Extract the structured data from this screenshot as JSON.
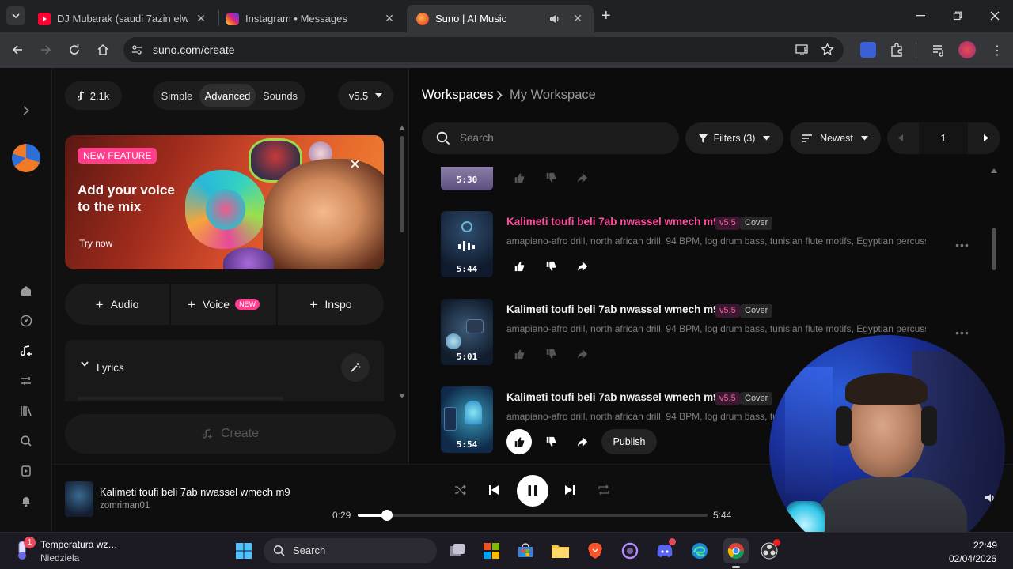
{
  "browser": {
    "tabs": [
      {
        "title": "DJ Mubarak (saudi 7azin elwat…",
        "close": "✕"
      },
      {
        "title": "Instagram • Messages",
        "close": "✕"
      },
      {
        "title": "Suno | AI Music",
        "close": "✕"
      }
    ],
    "new_tab": "+",
    "url": "suno.com/create"
  },
  "create": {
    "credits": "2.1k",
    "modes": [
      "Simple",
      "Advanced",
      "Sounds"
    ],
    "model": "v5.5",
    "banner": {
      "badge": "NEW FEATURE",
      "heading": "Add your voice to the mix",
      "cta": "Try now"
    },
    "quick_actions": [
      {
        "label": "Audio"
      },
      {
        "label": "Voice",
        "badge": "NEW"
      },
      {
        "label": "Inspo"
      }
    ],
    "lyrics_label": "Lyrics",
    "create_button": "Create"
  },
  "workspace": {
    "breadcrumb_root": "Workspaces",
    "breadcrumb_current": "My Workspace",
    "search_placeholder": "Search",
    "filters": "Filters (3)",
    "sort": "Newest",
    "page": "1",
    "partial_row_duration": "5:30",
    "songs": [
      {
        "title": "Kalimeti toufi beli 7ab nwassel wmech m9",
        "version": "v5.5",
        "type": "Cover",
        "tags": "amapiano-afro drill, north african drill, 94 BPM, log drum bass, tunisian flute motifs, Egyptian percussio…",
        "duration": "5:44",
        "highlight": true
      },
      {
        "title": "Kalimeti toufi beli 7ab nwassel wmech m9",
        "version": "v5.5",
        "type": "Cover",
        "tags": "amapiano-afro drill, north african drill, 94 BPM, log drum bass, tunisian flute motifs, Egyptian percussio…",
        "duration": "5:01",
        "highlight": false
      },
      {
        "title": "Kalimeti toufi beli 7ab nwassel wmech m9",
        "version": "v5.5",
        "type": "Cover",
        "tags": "amapiano-afro drill, north african drill, 94 BPM, log drum bass, tunis",
        "duration": "5:54",
        "highlight": false,
        "publish": "Publish"
      }
    ]
  },
  "player": {
    "title": "Kalimeti toufi beli 7ab nwassel wmech m9",
    "artist": "zomriman01",
    "elapsed": "0:29",
    "total": "5:44",
    "progress": 0.084
  },
  "taskbar": {
    "weather_title": "Temperatura wz…",
    "weather_sub": "Niedziela",
    "weather_badge": "1",
    "search": "Search",
    "time": "22:49",
    "date": "02/04/2026"
  },
  "colors": {
    "accent_pink": "#ff3d8b",
    "song_title_pink": "#ff4f9e"
  }
}
